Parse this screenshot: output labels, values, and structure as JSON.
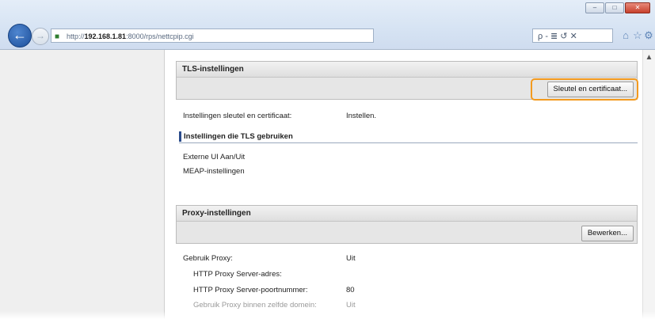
{
  "browser": {
    "url_prefix": "http://",
    "url_host": "192.168.1.81",
    "url_rest": ":8000/rps/nettcpip.cgi",
    "search_placeholder": "ρ - ≣ ↺ ✕",
    "window_buttons": [
      "–",
      "□",
      "✕"
    ],
    "toolbar_icons": [
      "home-icon",
      "star-icon",
      "gear-icon"
    ]
  },
  "tls": {
    "title": "TLS-instellingen",
    "button_label": "Sleutel en certificaat...",
    "setting_label": "Instellingen sleutel en certificaat:",
    "setting_value": "Instellen.",
    "section_title": "Instellingen die TLS gebruiken",
    "items": [
      "Externe UI Aan/Uit",
      "MEAP-instellingen"
    ]
  },
  "proxy": {
    "title": "Proxy-instellingen",
    "button_label": "Bewerken...",
    "rows": [
      {
        "label": "Gebruik Proxy:",
        "value": "Uit"
      },
      {
        "label": "HTTP Proxy Server-adres:",
        "value": ""
      },
      {
        "label": "HTTP Proxy Server-poortnummer:",
        "value": "80"
      },
      {
        "label": "Gebruik Proxy binnen zelfde domein:",
        "value": "Uit"
      }
    ]
  },
  "colors": {
    "highlight": "#f39a1e",
    "section_accent": "#2b4c8c"
  }
}
